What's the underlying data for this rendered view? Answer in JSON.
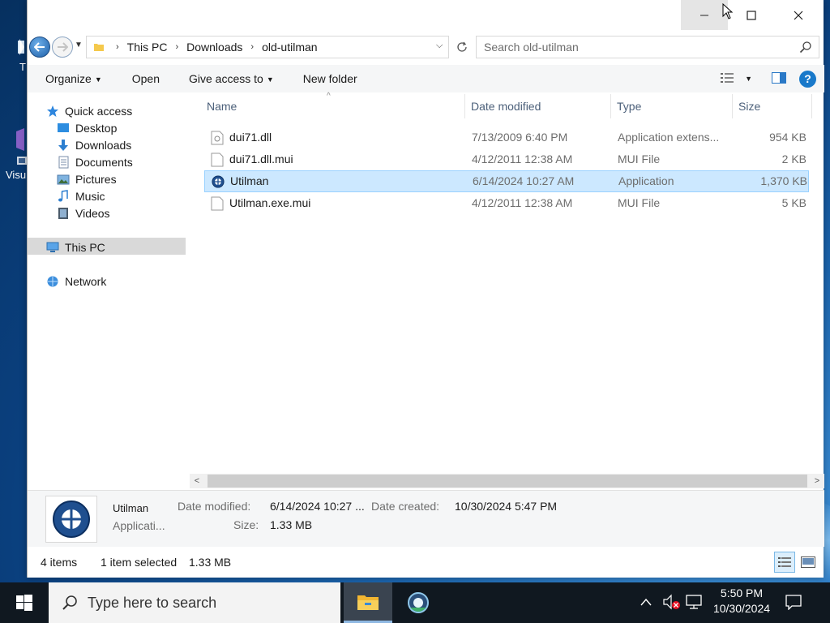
{
  "desktop": {
    "icons": [
      {
        "label": "T"
      },
      {
        "label": "Visu"
      }
    ]
  },
  "window": {
    "controls": {
      "minimize": "—",
      "maximize": "☐",
      "close": "✕"
    }
  },
  "address": {
    "crumbs": [
      "This PC",
      "Downloads",
      "old-utilman"
    ],
    "search_placeholder": "Search old-utilman"
  },
  "toolbar": {
    "organize": "Organize",
    "open": "Open",
    "give_access": "Give access to",
    "new_folder": "New folder"
  },
  "nav": {
    "quick_access": "Quick access",
    "desktop": "Desktop",
    "downloads": "Downloads",
    "documents": "Documents",
    "pictures": "Pictures",
    "music": "Music",
    "videos": "Videos",
    "this_pc": "This PC",
    "network": "Network"
  },
  "columns": {
    "name": "Name",
    "date": "Date modified",
    "type": "Type",
    "size": "Size"
  },
  "files": [
    {
      "name": "dui71.dll",
      "date": "7/13/2009 6:40 PM",
      "type": "Application extens...",
      "size": "954 KB"
    },
    {
      "name": "dui71.dll.mui",
      "date": "4/12/2011 12:38 AM",
      "type": "MUI File",
      "size": "2 KB"
    },
    {
      "name": "Utilman",
      "date": "6/14/2024 10:27 AM",
      "type": "Application",
      "size": "1,370 KB"
    },
    {
      "name": "Utilman.exe.mui",
      "date": "4/12/2011 12:38 AM",
      "type": "MUI File",
      "size": "5 KB"
    }
  ],
  "details": {
    "name": "Utilman",
    "type": "Applicati...",
    "date_modified_label": "Date modified:",
    "date_modified": "6/14/2024 10:27 ...",
    "date_created_label": "Date created:",
    "date_created": "10/30/2024 5:47 PM",
    "size_label": "Size:",
    "size": "1.33 MB"
  },
  "status": {
    "count": "4 items",
    "selected": "1 item selected",
    "selected_size": "1.33 MB"
  },
  "taskbar": {
    "search_placeholder": "Type here to search",
    "time": "5:50 PM",
    "date": "10/30/2024"
  }
}
